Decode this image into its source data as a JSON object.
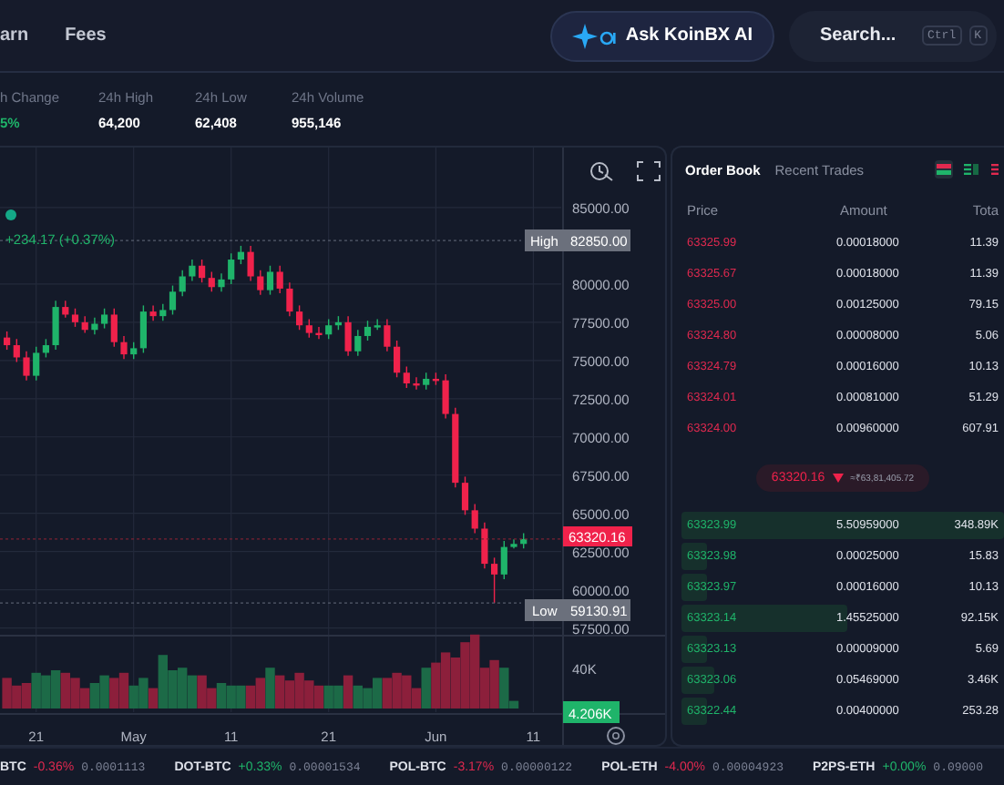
{
  "nav": {
    "items": [
      "arn",
      "Fees"
    ]
  },
  "ask_ai": {
    "label": "Ask KoinBX AI"
  },
  "search": {
    "placeholder": "Search...",
    "keys": [
      "Ctrl",
      "K"
    ]
  },
  "stats": [
    {
      "label": "h Change",
      "value": "5%",
      "positive": true
    },
    {
      "label": "24h High",
      "value": "64,200",
      "positive": false
    },
    {
      "label": "24h Low",
      "value": "62,408",
      "positive": false
    },
    {
      "label": "24h Volume",
      "value": "955,146",
      "positive": false
    }
  ],
  "chart": {
    "change": "+234.17 (+0.37%)",
    "chart_data": {
      "type": "candlestick",
      "categories": [
        null,
        null,
        null,
        "21",
        null,
        null,
        null,
        null,
        null,
        null,
        null,
        null,
        null,
        "May",
        null,
        null,
        null,
        null,
        null,
        null,
        null,
        null,
        null,
        "11",
        null,
        null,
        null,
        null,
        null,
        null,
        null,
        null,
        null,
        "21",
        null,
        null,
        null,
        null,
        null,
        null,
        null,
        null,
        null,
        null,
        "Jun",
        null,
        null,
        null,
        null,
        null,
        null,
        null,
        null,
        null,
        "11"
      ],
      "ohlc": [
        [
          76500,
          76900,
          75700,
          76000
        ],
        [
          76000,
          76400,
          74900,
          75200
        ],
        [
          75200,
          75600,
          73700,
          74000
        ],
        [
          74000,
          75900,
          73700,
          75500
        ],
        [
          75500,
          76400,
          75200,
          76000
        ],
        [
          76000,
          78900,
          75700,
          78500
        ],
        [
          78500,
          78900,
          77800,
          78000
        ],
        [
          78000,
          78400,
          77200,
          77500
        ],
        [
          77500,
          77900,
          76800,
          77000
        ],
        [
          77000,
          77800,
          76700,
          77400
        ],
        [
          77400,
          78400,
          77100,
          78000
        ],
        [
          78000,
          78400,
          75900,
          76200
        ],
        [
          76200,
          76600,
          75100,
          75400
        ],
        [
          75400,
          76200,
          75100,
          75800
        ],
        [
          75800,
          78600,
          75500,
          78200
        ],
        [
          78200,
          78600,
          77600,
          77900
        ],
        [
          77900,
          78700,
          77600,
          78300
        ],
        [
          78300,
          79900,
          78000,
          79500
        ],
        [
          79500,
          80900,
          79200,
          80500
        ],
        [
          80500,
          81600,
          80200,
          81200
        ],
        [
          81200,
          81600,
          80100,
          80400
        ],
        [
          80400,
          80800,
          79500,
          79800
        ],
        [
          79800,
          80700,
          79500,
          80300
        ],
        [
          80300,
          82000,
          80000,
          81600
        ],
        [
          81600,
          82500,
          81300,
          82100
        ],
        [
          82100,
          82500,
          80200,
          80500
        ],
        [
          80500,
          80900,
          79300,
          79600
        ],
        [
          79600,
          81200,
          79300,
          80800
        ],
        [
          80800,
          81200,
          79400,
          79700
        ],
        [
          79700,
          80100,
          77900,
          78200
        ],
        [
          78200,
          78600,
          77000,
          77300
        ],
        [
          77300,
          77700,
          76500,
          76800
        ],
        [
          76800,
          77200,
          76400,
          76700
        ],
        [
          76700,
          77700,
          76400,
          77300
        ],
        [
          77300,
          77900,
          77000,
          77500
        ],
        [
          77500,
          77900,
          75300,
          75600
        ],
        [
          75600,
          77000,
          75300,
          76600
        ],
        [
          76600,
          77600,
          76300,
          77200
        ],
        [
          77200,
          77700,
          77000,
          77300
        ],
        [
          77300,
          77700,
          75600,
          75900
        ],
        [
          75900,
          76300,
          73900,
          74200
        ],
        [
          74200,
          74600,
          73200,
          73500
        ],
        [
          73500,
          73900,
          73100,
          73400
        ],
        [
          73400,
          74200,
          73100,
          73800
        ],
        [
          73800,
          74200,
          73400,
          73700
        ],
        [
          73700,
          74100,
          71200,
          71500
        ],
        [
          71500,
          71900,
          66700,
          67000
        ],
        [
          67000,
          67400,
          64900,
          65200
        ],
        [
          65200,
          65600,
          63700,
          64000
        ],
        [
          64000,
          64400,
          61400,
          61700
        ],
        [
          61700,
          62100,
          59130,
          61000
        ],
        [
          61000,
          63200,
          60700,
          62800
        ],
        [
          62800,
          63300,
          62700,
          63000
        ],
        [
          63000,
          63700,
          62700,
          63320
        ],
        null
      ],
      "ylim": [
        49851,
        88929
      ],
      "grid": true,
      "yticks": [
        {
          "value": 85000,
          "label": "85000.00"
        },
        {
          "value": 80000,
          "label": "80000.00"
        },
        {
          "value": 77500,
          "label": "77500.00"
        },
        {
          "value": 75000,
          "label": "75000.00"
        },
        {
          "value": 72500,
          "label": "72500.00"
        },
        {
          "value": 70000,
          "label": "70000.00"
        },
        {
          "value": 67500,
          "label": "67500.00"
        },
        {
          "value": 65000,
          "label": "65000.00"
        },
        {
          "value": 62500,
          "label": "62500.00"
        },
        {
          "value": 60000,
          "label": "60000.00"
        },
        {
          "value": 57500,
          "label": "57500.00"
        }
      ]
    },
    "high": {
      "label": "High",
      "value": "82850.00"
    },
    "low": {
      "label": "Low",
      "value": "59130.91"
    },
    "last_price": "63320.16",
    "volume_tick": "40K",
    "last_volume": "4.206K"
  },
  "order_book": {
    "tabs": [
      {
        "label": "Order Book",
        "selected": true
      },
      {
        "label": "Recent Trades",
        "selected": false
      }
    ],
    "columns": [
      "Price",
      "Amount",
      "Tota"
    ],
    "asks": [
      {
        "price": "63325.99",
        "amount": "0.00018000",
        "total": "11.39"
      },
      {
        "price": "63325.67",
        "amount": "0.00018000",
        "total": "11.39"
      },
      {
        "price": "63325.00",
        "amount": "0.00125000",
        "total": "79.15"
      },
      {
        "price": "63324.80",
        "amount": "0.00008000",
        "total": "5.06"
      },
      {
        "price": "63324.79",
        "amount": "0.00016000",
        "total": "10.13"
      },
      {
        "price": "63324.01",
        "amount": "0.00081000",
        "total": "51.29"
      },
      {
        "price": "63324.00",
        "amount": "0.00960000",
        "total": "607.91"
      }
    ],
    "mid": {
      "price": "63320.16",
      "fiat": "≈₹63,81,405.72"
    },
    "bids": [
      {
        "price": "63323.99",
        "amount": "5.50959000",
        "total": "348.89K"
      },
      {
        "price": "63323.98",
        "amount": "0.00025000",
        "total": "15.83"
      },
      {
        "price": "63323.97",
        "amount": "0.00016000",
        "total": "10.13"
      },
      {
        "price": "63323.14",
        "amount": "1.45525000",
        "total": "92.15K"
      },
      {
        "price": "63323.13",
        "amount": "0.00009000",
        "total": "5.69"
      },
      {
        "price": "63323.06",
        "amount": "0.05469000",
        "total": "3.46K"
      },
      {
        "price": "63322.44",
        "amount": "0.00400000",
        "total": "253.28"
      }
    ]
  },
  "ticker": [
    {
      "pair": "BTC",
      "change": "-0.36%",
      "price": "0.0001113",
      "positive": false
    },
    {
      "pair": "DOT-BTC",
      "change": "+0.33%",
      "price": "0.00001534",
      "positive": true
    },
    {
      "pair": "POL-BTC",
      "change": "-3.17%",
      "price": "0.00000122",
      "positive": false
    },
    {
      "pair": "POL-ETH",
      "change": "-4.00%",
      "price": "0.00004923",
      "positive": false
    },
    {
      "pair": "P2PS-ETH",
      "change": "+0.00%",
      "price": "0.09000",
      "positive": true
    }
  ]
}
